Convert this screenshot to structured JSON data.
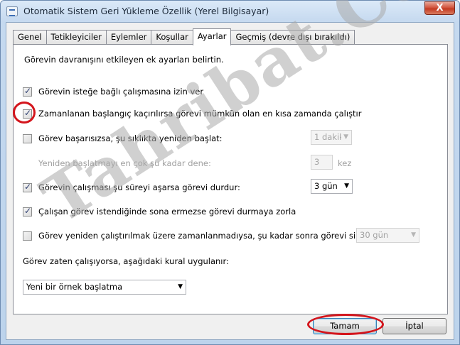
{
  "window": {
    "title": "Otomatik Sistem Geri Yükleme Özellik (Yerel Bilgisayar)",
    "close_symbol": "X"
  },
  "tabs": [
    {
      "label": "Genel",
      "active": false
    },
    {
      "label": "Tetikleyiciler",
      "active": false
    },
    {
      "label": "Eylemler",
      "active": false
    },
    {
      "label": "Koşullar",
      "active": false
    },
    {
      "label": "Ayarlar",
      "active": true
    },
    {
      "label": "Geçmiş (devre dışı bırakıldı)",
      "active": false
    }
  ],
  "settings": {
    "description": "Görevin davranışını etkileyen ek ayarları belirtin.",
    "allow_on_demand": {
      "label": "Görevin isteğe bağlı çalışmasına izin ver",
      "checked": true
    },
    "run_missed_start": {
      "label": "Zamanlanan başlangıç kaçırılırsa görevi mümkün olan en kısa zamanda çalıştır",
      "checked": true
    },
    "restart_on_failure": {
      "label": "Görev başarısızsa, şu sıklıkta yeniden başlat:",
      "checked": false,
      "value": "1 dakika"
    },
    "restart_attempts": {
      "label": "Yeniden başlatmayı en çok şu kadar dene:",
      "value": "3",
      "unit": "kez"
    },
    "stop_if_longer": {
      "label": "Görevin çalışması şu süreyi aşarsa görevi durdur:",
      "checked": true,
      "value": "3 gün"
    },
    "force_stop": {
      "label": "Çalışan görev istendiğinde sona ermezse görevi durmaya zorla",
      "checked": true
    },
    "delete_if_not_scheduled": {
      "label": "Görev yeniden çalıştırılmak üzere zamanlanmadıysa, şu kadar sonra görevi sil:",
      "checked": false,
      "value": "30 gün"
    },
    "if_running_label": "Görev zaten çalışıyorsa, aşağıdaki kural uygulanır:",
    "if_running_value": "Yeni bir örnek başlatma"
  },
  "buttons": {
    "ok": "Tamam",
    "cancel": "İptal"
  },
  "watermark": "Tahribat.Com",
  "colors": {
    "annotation_red": "#d4151c",
    "title_bar": "#c5d9ef"
  }
}
